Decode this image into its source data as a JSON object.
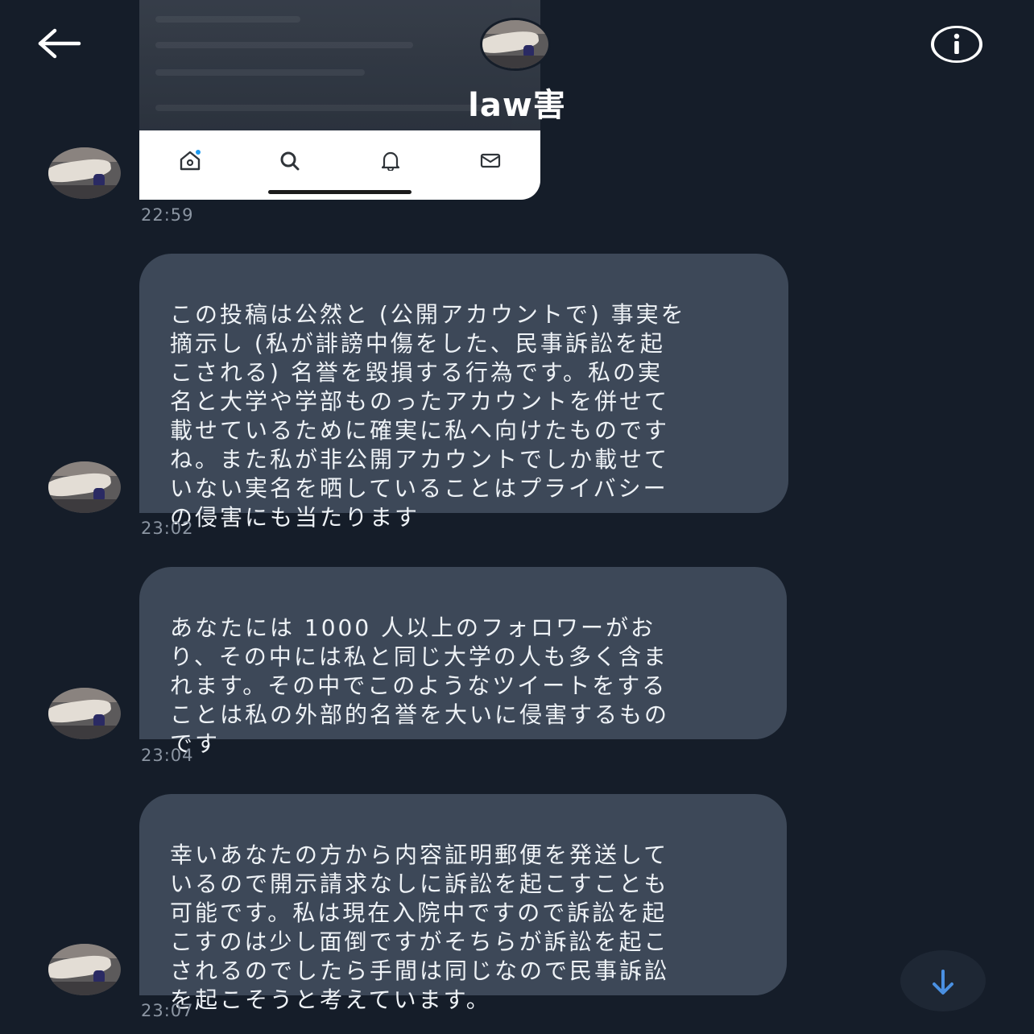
{
  "conversation": {
    "title": "law害",
    "back_icon": "arrow-left-icon",
    "info_icon": "info-icon"
  },
  "shared_image": {
    "tabs": [
      "home-icon",
      "search-icon",
      "bell-icon",
      "mail-icon"
    ],
    "colors": {
      "background": "#ffffff",
      "icon": "#2f3439",
      "badge": "#1d9bf0"
    }
  },
  "messages": [
    {
      "time": "22:59"
    },
    {
      "text": "この投稿は公然と (公開アカウントで) 事実を\n摘示し (私が誹謗中傷をした、民事訴訟を起\nこされる) 名誉を毀損する行為です。私の実\n名と大学や学部ものったアカウントを併せて\n載せているために確実に私へ向けたものです\nね。また私が非公開アカウントでしか載せて\nいない実名を晒していることはプライバシー\nの侵害にも当たります",
      "time": "23:02"
    },
    {
      "text": "あなたには 1000 人以上のフォロワーがお\nり、その中には私と同じ大学の人も多く含ま\nれます。その中でこのようなツイートをする\nことは私の外部的名誉を大いに侵害するもの\nです",
      "time": "23:04"
    },
    {
      "text": "幸いあなたの方から内容証明郵便を発送して\nいるので開示請求なしに訴訟を起こすことも\n可能です。私は現在入院中ですので訴訟を起\nこすのは少し面倒ですがそちらが訴訟を起こ\nされるのでしたら手間は同じなので民事訴訟\nを起こそうと考えています。",
      "time": "23:07"
    }
  ],
  "scroll_button": {
    "icon": "arrow-down-icon",
    "color": "#4a90e2"
  },
  "theme": {
    "background": "#151d29",
    "bubble": "#3d4858",
    "timestamp": "#8b95a2"
  }
}
